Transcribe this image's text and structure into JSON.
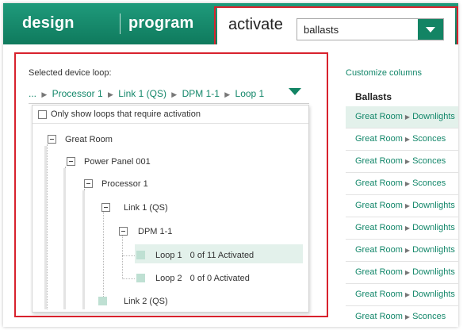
{
  "topbar": {
    "design_label": "design",
    "program_label": "program",
    "activate_label": "activate",
    "activate_dropdown_value": "ballasts"
  },
  "loop_selector": {
    "label": "Selected device loop:",
    "path": [
      "...",
      "Processor 1",
      "Link 1 (QS)",
      "DPM 1-1",
      "Loop 1"
    ],
    "only_show_label": "Only show loops that require activation"
  },
  "tree": {
    "great_room": "Great Room",
    "power_panel": "Power Panel 001",
    "processor": "Processor 1",
    "link1": "Link 1 (QS)",
    "dpm": "DPM 1-1",
    "loop1": "Loop 1",
    "loop1_count": "0 of 11 Activated",
    "loop2": "Loop 2",
    "loop2_count": "0 of 0 Activated",
    "link2": "Link 2 (QS)"
  },
  "right_panel": {
    "customize_label": "Customize columns",
    "column_header": "Ballasts",
    "rows": [
      {
        "area": "Great Room",
        "zone": "Downlights"
      },
      {
        "area": "Great Room",
        "zone": "Sconces"
      },
      {
        "area": "Great Room",
        "zone": "Sconces"
      },
      {
        "area": "Great Room",
        "zone": "Sconces"
      },
      {
        "area": "Great Room",
        "zone": "Downlights"
      },
      {
        "area": "Great Room",
        "zone": "Downlights"
      },
      {
        "area": "Great Room",
        "zone": "Downlights"
      },
      {
        "area": "Great Room",
        "zone": "Downlights"
      },
      {
        "area": "Great Room",
        "zone": "Downlights"
      },
      {
        "area": "Great Room",
        "zone": "Sconces"
      }
    ]
  },
  "colors": {
    "brand_green": "#138464",
    "highlight_red": "#d8222d",
    "selection_bg": "#e3f1eb"
  }
}
